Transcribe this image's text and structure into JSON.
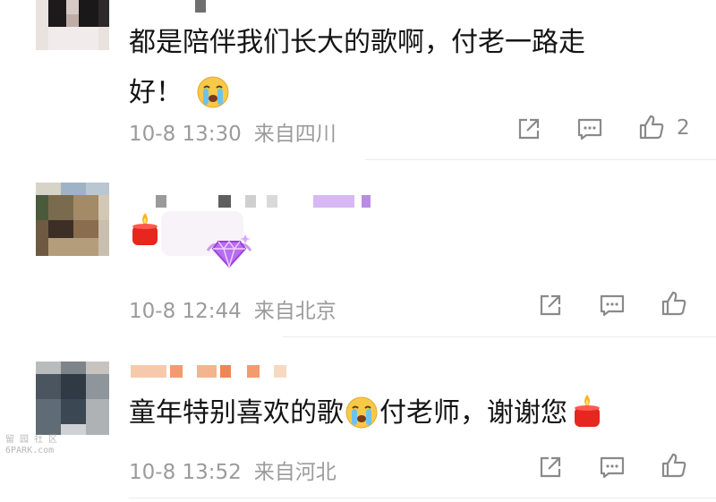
{
  "comments": [
    {
      "text_line1": "都是陪伴我们长大的歌啊，付老一路走",
      "text_line2": "好！",
      "date": "10-8 13:30",
      "location": "来自四川",
      "like_count": "2"
    },
    {
      "date": "10-8 12:44",
      "location": "来自北京"
    },
    {
      "text_part1": "童年特别喜欢的歌",
      "text_part2": "付老师，谢谢您",
      "date": "10-8 13:52",
      "location": "来自河北"
    }
  ],
  "watermark": {
    "line1": "留 园 社 区",
    "line2": "6PARK.com"
  },
  "colors": {
    "text": "#141414",
    "meta": "#9b9b9b",
    "icon": "#8a8a8a",
    "divider": "#ececec"
  },
  "icons": [
    "share-icon",
    "comment-icon",
    "like-icon",
    "crying-emoji-icon",
    "candle-emoji-icon",
    "gem-badge-icon"
  ]
}
